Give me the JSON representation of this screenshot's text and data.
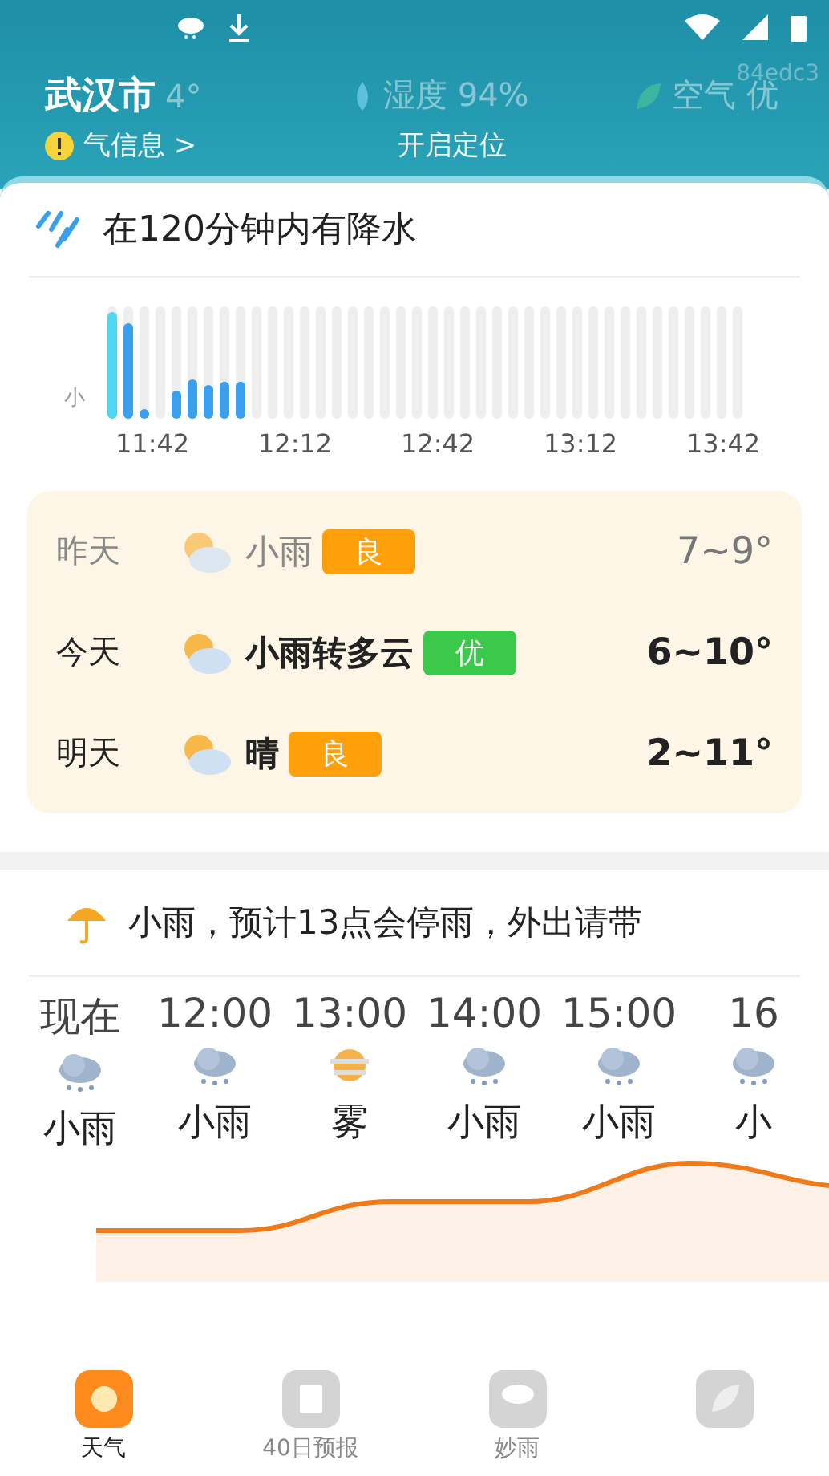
{
  "status_bar": {
    "tag": "84edc3"
  },
  "header": {
    "city": "武汉市",
    "feels": "4°",
    "humidity": "湿度 94%",
    "air": "空气 优",
    "alert": "气信息 >",
    "location": "开启定位"
  },
  "rain": {
    "title": "在120分钟内有降水",
    "scale": "小",
    "times": [
      "11:42",
      "12:12",
      "12:42",
      "13:12",
      "13:42"
    ]
  },
  "days": [
    {
      "day": "昨天",
      "weather": "小雨",
      "aqi": "良",
      "color": "#ff9f0a",
      "temp": "7~9°",
      "past": true
    },
    {
      "day": "今天",
      "weather": "小雨转多云",
      "aqi": "优",
      "color": "#3cc84a",
      "temp": "6~10°",
      "past": false
    },
    {
      "day": "明天",
      "weather": "晴",
      "aqi": "良",
      "color": "#ff9f0a",
      "temp": "2~11°",
      "past": false
    }
  ],
  "tip": "小雨，预计13点会停雨，外出请带",
  "hours": [
    {
      "time": "现在",
      "weather": "小雨",
      "kind": "rain"
    },
    {
      "time": "12:00",
      "weather": "小雨",
      "kind": "rain"
    },
    {
      "time": "13:00",
      "weather": "雾",
      "kind": "fog"
    },
    {
      "time": "14:00",
      "weather": "小雨",
      "kind": "rain"
    },
    {
      "time": "15:00",
      "weather": "小雨",
      "kind": "rain"
    },
    {
      "time": "16",
      "weather": "小",
      "kind": "rain"
    }
  ],
  "nav": [
    {
      "label": "天气",
      "selected": true
    },
    {
      "label": "40日预报",
      "selected": false
    },
    {
      "label": "妙雨",
      "selected": false
    },
    {
      "selected": false
    }
  ]
}
